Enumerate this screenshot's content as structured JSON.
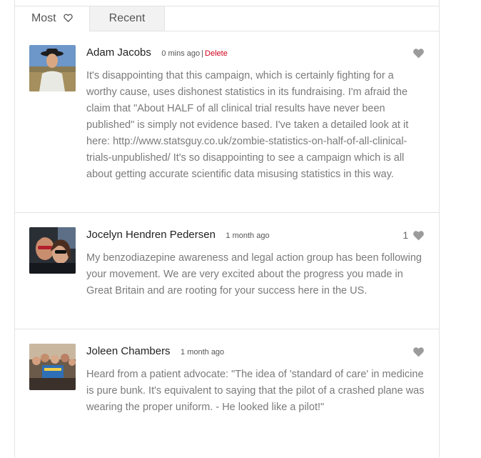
{
  "tabs": [
    {
      "label": "Most",
      "active": true
    },
    {
      "label": "Recent",
      "active": false
    }
  ],
  "comments": [
    {
      "author": "Adam Jacobs",
      "time": "0 mins ago",
      "separator": "|",
      "delete_label": "Delete",
      "likes": "",
      "text": "It's disappointing that this campaign, which is certainly fighting for a worthy cause, uses dishonest statistics in its fundraising. I'm afraid the claim that \"About HALF of all clinical trial results have never been published\" is simply not evidence based. I've taken a detailed look at it here: http://www.statsguy.co.uk/zombie-statistics-on-half-of-all-clinical-trials-unpublished/ It's so disappointing to see a campaign which is all about getting accurate scientific data misusing statistics in this way."
    },
    {
      "author": "Jocelyn Hendren Pedersen",
      "time": "1 month ago",
      "likes": "1",
      "text": "My benzodiazepine awareness and legal action group has been following your movement. We are very excited about the progress you made in Great Britain and are rooting for your success here in the US."
    },
    {
      "author": "Joleen Chambers",
      "time": "1 month ago",
      "likes": "",
      "text": "Heard from a patient advocate: \"The idea of 'standard of care' in medicine is pure bunk. It's equivalent to saying that the pilot of a crashed plane was wearing the proper uniform. - He looked like a pilot!\""
    }
  ],
  "colors": {
    "delete": "#d0021b",
    "heart": "#9b9b9b",
    "body_text": "#7a7a7a",
    "border": "#e3e3e3"
  },
  "icons": {
    "tab_icon": "heart-outline-icon",
    "like_icon": "heart-icon"
  }
}
